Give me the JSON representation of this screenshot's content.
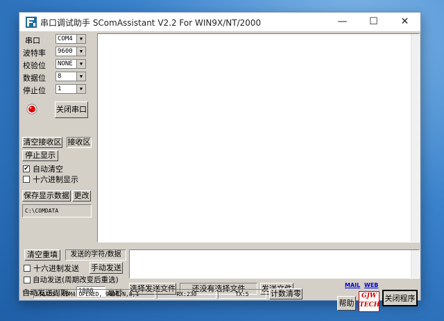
{
  "window": {
    "title": "串口调试助手 SComAssistant V2.2 For WIN9X/NT/2000",
    "minimize": "—",
    "maximize": "☐",
    "close": "✕"
  },
  "settings": {
    "port_label": "串口",
    "port_value": "COM4",
    "baud_label": "波特率",
    "baud_value": "9600",
    "parity_label": "校验位",
    "parity_value": "NONE",
    "databits_label": "数据位",
    "databits_value": "8",
    "stopbits_label": "停止位",
    "stopbits_value": "1",
    "led_color": "#e00000",
    "toggle_port_button": "关闭串口"
  },
  "receive": {
    "clear_button": "清空接收区",
    "area_label": "接收区",
    "stop_display_button": "停止显示",
    "auto_clear_label": "自动清空",
    "auto_clear_checked": true,
    "hex_display_label": "十六进制显示",
    "hex_display_checked": false,
    "save_button": "保存显示数据",
    "change_button": "更改",
    "path": "C:\\COMDATA",
    "content": ""
  },
  "send": {
    "clear_button": "清空重填",
    "area_label": "发送的字符/数据",
    "hex_send_label": "十六进制发送",
    "hex_send_checked": false,
    "manual_send_button": "手动发送",
    "auto_send_label": "自动发送(周期改变后重选)",
    "auto_send_checked": false,
    "period_label": "自动发送周期:",
    "period_value": "1000",
    "period_unit": "毫秒",
    "select_file_button": "选择发送文件",
    "no_file_text": "还没有选择文件",
    "send_file_button": "发送文件",
    "content": ""
  },
  "links": {
    "mail": "MAIL",
    "web": "WEB"
  },
  "status": {
    "port_status": "STATUS: COM4 OPENED, 9600,N,8,1",
    "rx": "RX:230",
    "tx": "TX:5",
    "reset_count_button": "计数清零"
  },
  "footer": {
    "help_button": "帮助",
    "logo_text": "GJW TECH",
    "close_program_button": "关闭程序"
  }
}
